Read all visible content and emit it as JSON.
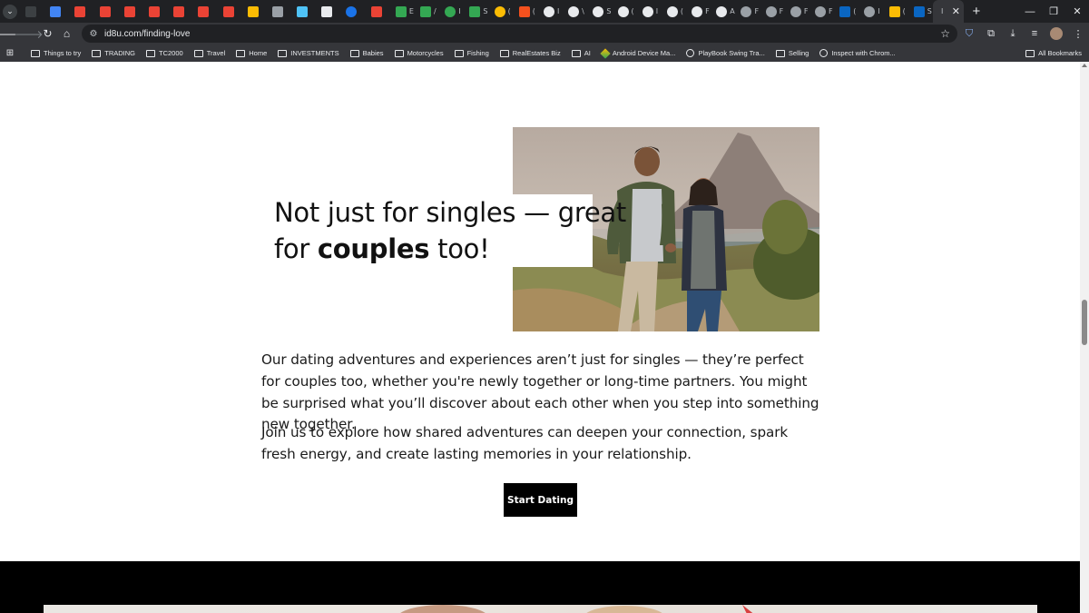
{
  "browser": {
    "tabs": [
      {
        "icon": "expand-icon",
        "color": "#3c4043",
        "char": ""
      },
      {
        "icon": "google-calendar-icon",
        "color": "#4285f4",
        "char": ""
      },
      {
        "icon": "gmail-icon",
        "color": "#ea4335",
        "char": ""
      },
      {
        "icon": "gmail-icon",
        "color": "#ea4335",
        "char": ""
      },
      {
        "icon": "gmail-icon",
        "color": "#ea4335",
        "char": ""
      },
      {
        "icon": "gmail-icon",
        "color": "#ea4335",
        "char": ""
      },
      {
        "icon": "gmail-icon",
        "color": "#ea4335",
        "char": ""
      },
      {
        "icon": "gmail-icon",
        "color": "#ea4335",
        "char": ""
      },
      {
        "icon": "gmail-icon",
        "color": "#ea4335",
        "char": ""
      },
      {
        "icon": "google-drive-icon",
        "color": "#fbbc04",
        "char": ""
      },
      {
        "icon": "audio-icon",
        "color": "#9aa0a6",
        "char": ""
      },
      {
        "icon": "app-icon",
        "color": "#4fc3f7",
        "char": ""
      },
      {
        "icon": "shield-icon",
        "color": "#e8eaed",
        "char": ""
      },
      {
        "icon": "blue-circle-icon",
        "color": "#1a73e8",
        "char": ""
      },
      {
        "icon": "red-app-icon",
        "color": "#ea4335",
        "char": ""
      },
      {
        "icon": "sheets-icon",
        "color": "#34a853",
        "char": "E"
      },
      {
        "icon": "sheets-icon",
        "color": "#34a853",
        "char": "/"
      },
      {
        "icon": "green-plus-icon",
        "color": "#34a853",
        "char": "I"
      },
      {
        "icon": "sheets-icon",
        "color": "#34a853",
        "char": "S"
      },
      {
        "icon": "yellow-circle-icon",
        "color": "#fbbc04",
        "char": "("
      },
      {
        "icon": "orange-burst-icon",
        "color": "#f4511e",
        "char": "("
      },
      {
        "icon": "github-icon",
        "color": "#e8eaed",
        "char": "I"
      },
      {
        "icon": "github-icon",
        "color": "#e8eaed",
        "char": "\\"
      },
      {
        "icon": "github-icon",
        "color": "#e8eaed",
        "char": "S"
      },
      {
        "icon": "github-icon",
        "color": "#e8eaed",
        "char": "("
      },
      {
        "icon": "github-icon",
        "color": "#e8eaed",
        "char": "I"
      },
      {
        "icon": "github-icon",
        "color": "#e8eaed",
        "char": "("
      },
      {
        "icon": "github-icon",
        "color": "#e8eaed",
        "char": "F"
      },
      {
        "icon": "github-icon",
        "color": "#e8eaed",
        "char": "A"
      },
      {
        "icon": "globe-icon",
        "color": "#9aa0a6",
        "char": "F"
      },
      {
        "icon": "globe-icon",
        "color": "#9aa0a6",
        "char": "F"
      },
      {
        "icon": "globe-icon",
        "color": "#9aa0a6",
        "char": "F"
      },
      {
        "icon": "globe-icon",
        "color": "#9aa0a6",
        "char": "F"
      },
      {
        "icon": "linkedin-icon",
        "color": "#0a66c2",
        "char": "("
      },
      {
        "icon": "globe-icon",
        "color": "#9aa0a6",
        "char": "I"
      },
      {
        "icon": "colorful-app-icon",
        "color": "#fbbc04",
        "char": "("
      },
      {
        "icon": "linkedin-icon",
        "color": "#0a66c2",
        "char": "S"
      }
    ],
    "active_tab": {
      "char": "I",
      "close": "✕"
    },
    "new_tab": "+",
    "window_controls": [
      "—",
      "❐",
      "✕"
    ],
    "url": "id8u.com/finding-love",
    "bookmarks": [
      {
        "type": "folder",
        "label": "Things to try"
      },
      {
        "type": "folder",
        "label": "TRADING"
      },
      {
        "type": "folder",
        "label": "TC2000"
      },
      {
        "type": "folder",
        "label": "Travel"
      },
      {
        "type": "folder",
        "label": "Home"
      },
      {
        "type": "folder",
        "label": "INVESTMENTS"
      },
      {
        "type": "folder",
        "label": "Babies"
      },
      {
        "type": "folder",
        "label": "Motorcycles"
      },
      {
        "type": "folder",
        "label": "Fishing"
      },
      {
        "type": "folder",
        "label": "RealEstates Biz"
      },
      {
        "type": "folder",
        "label": "AI"
      },
      {
        "type": "android",
        "label": "Android Device Ma..."
      },
      {
        "type": "globe",
        "label": "PlayBook Swing Tra..."
      },
      {
        "type": "folder",
        "label": "Selling"
      },
      {
        "type": "globe",
        "label": "Inspect with Chrom..."
      }
    ],
    "all_bookmarks": "All Bookmarks"
  },
  "page": {
    "headline": {
      "line1": "Not just for singles — great",
      "line2_pre": "for ",
      "line2_bold": "couples",
      "line2_post": " too!"
    },
    "paragraph1": "Our dating adventures and experiences aren’t just for singles — they’re perfect for couples too, whether you're newly together or long-time partners. You might be surprised what you’ll discover about each other when you step into something new together.",
    "paragraph2": "Join us to explore how shared adventures can deepen your connection, spark fresh energy, and create lasting memories in your relationship.",
    "cta_label": "Start Dating",
    "colors": {
      "cta_bg": "#000000",
      "text": "#111111",
      "dark_section": "#000000"
    }
  }
}
